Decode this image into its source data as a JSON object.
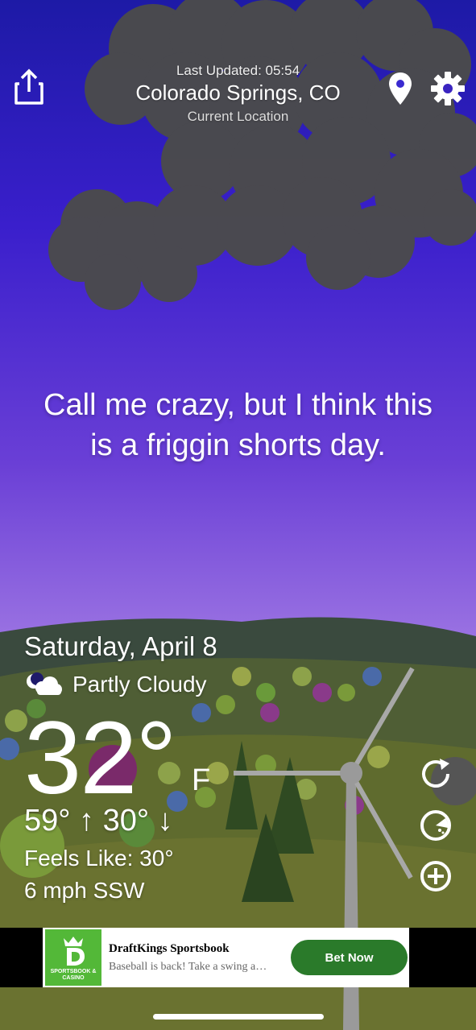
{
  "header": {
    "last_updated": "Last Updated: 05:54",
    "city": "Colorado Springs, CO",
    "location_label": "Current Location"
  },
  "message": {
    "line1": "Call me crazy, but I think this",
    "line2": "is a friggin shorts day."
  },
  "weather": {
    "date": "Saturday, April 8",
    "condition": "Partly Cloudy",
    "condition_icon": "moon-cloud-icon",
    "temperature": "32°",
    "unit": "F",
    "hilo": "59° ↑ 30° ↓",
    "feels_like": "Feels Like: 30°",
    "wind": "6 mph SSW"
  },
  "actions": {
    "refresh_icon": "refresh-icon",
    "radar_icon": "radar-icon",
    "add_icon": "add-icon"
  },
  "ad": {
    "logo_text": "SPORTSBOOK & CASINO",
    "title": "DraftKings Sportsbook",
    "subtitle": "Baseball is back! Take a swing a…",
    "cta": "Bet Now"
  },
  "colors": {
    "sky_top": "#1d1aa6",
    "sky_bottom": "#c5b0f4",
    "cloud": "#4a4a4a",
    "hill": "#5f6b2e",
    "ad_green": "#53b838",
    "cta_green": "#2a7a2a"
  }
}
